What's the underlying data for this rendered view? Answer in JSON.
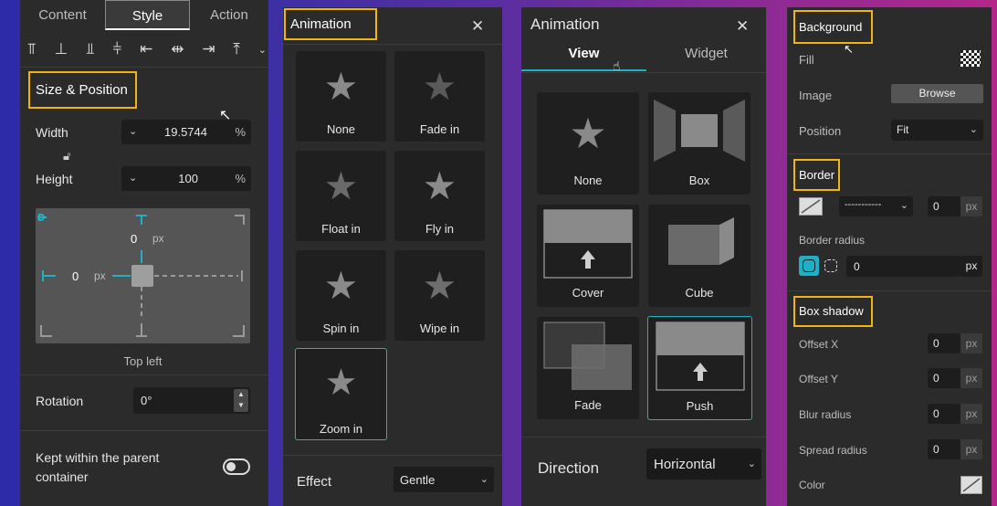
{
  "p1": {
    "tabs": [
      "Content",
      "Style",
      "Action"
    ],
    "section": "Size & Position",
    "width_label": "Width",
    "width_value": "19.5744",
    "width_unit": "%",
    "height_label": "Height",
    "height_value": "100",
    "height_unit": "%",
    "top_value": "0",
    "top_unit": "px",
    "left_value": "0",
    "left_unit": "px",
    "anchor": "Top left",
    "rotation_label": "Rotation",
    "rotation_value": "0°",
    "kept_label": "Kept within the parent container"
  },
  "p2": {
    "title": "Animation",
    "items": [
      "None",
      "Fade in",
      "Float in",
      "Fly in",
      "Spin in",
      "Wipe in",
      "Zoom in"
    ],
    "effect_label": "Effect",
    "effect_value": "Gentle"
  },
  "p3": {
    "title": "Animation",
    "tabs": [
      "View",
      "Widget"
    ],
    "items": [
      "None",
      "Box",
      "Cover",
      "Cube",
      "Fade",
      "Push"
    ],
    "direction_label": "Direction",
    "direction_value": "Horizontal"
  },
  "p4": {
    "background": "Background",
    "fill": "Fill",
    "image": "Image",
    "browse": "Browse",
    "position": "Position",
    "position_value": "Fit",
    "border": "Border",
    "border_style": "-----------",
    "border_width": "0",
    "px": "px",
    "border_radius": "Border radius",
    "radius_value": "0",
    "box_shadow": "Box shadow",
    "offset_x": "Offset X",
    "offset_y": "Offset Y",
    "blur": "Blur radius",
    "spread": "Spread radius",
    "shadow_value": "0",
    "color": "Color"
  },
  "colors": {
    "highlight": "#f2b412",
    "accent": "#1fb0c6",
    "panel": "#2b2b2b"
  }
}
